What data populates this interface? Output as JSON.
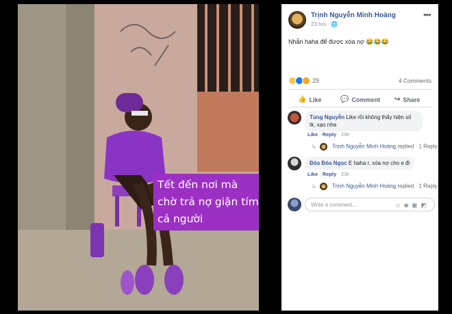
{
  "photo": {
    "caption": "Tết đến nơi mà chờ trả nợ giận tím cả người"
  },
  "post": {
    "author": "Trịnh Nguyễn Minh Hoàng",
    "time": "23 hrs",
    "privacy_icon": "globe-icon",
    "text": "Nhẫn haha để được xóa nợ 😂😂😂",
    "reaction_count": "29",
    "reaction_icons": [
      "haha-reaction-icon",
      "like-reaction-icon",
      "wow-reaction-icon"
    ],
    "comment_count": "4 Comments"
  },
  "actions": {
    "like": "Like",
    "comment": "Comment",
    "share": "Share"
  },
  "comments": [
    {
      "author": "Tùng Nguyễn",
      "text": "Like rồi không thấy hiện số tk, xạo nha",
      "like": "Like",
      "reply": "Reply",
      "time": "23h",
      "reply_author": "Trịnh Nguyễn Minh Hoàng",
      "reply_text": "replied · 1 Reply"
    },
    {
      "author": "Đóa Đóa Ngọc",
      "text": "E haha r, xóa nợ cho e đi",
      "like": "Like",
      "reply": "Reply",
      "time": "23h",
      "reply_author": "Trịnh Nguyễn Minh Hoàng",
      "reply_text": "replied · 1 Reply"
    }
  ],
  "composer": {
    "placeholder": "Write a comment..."
  },
  "colors": {
    "link": "#385898",
    "caption_bg": "#9c2fc4",
    "outfit": "#7b2fb0"
  }
}
